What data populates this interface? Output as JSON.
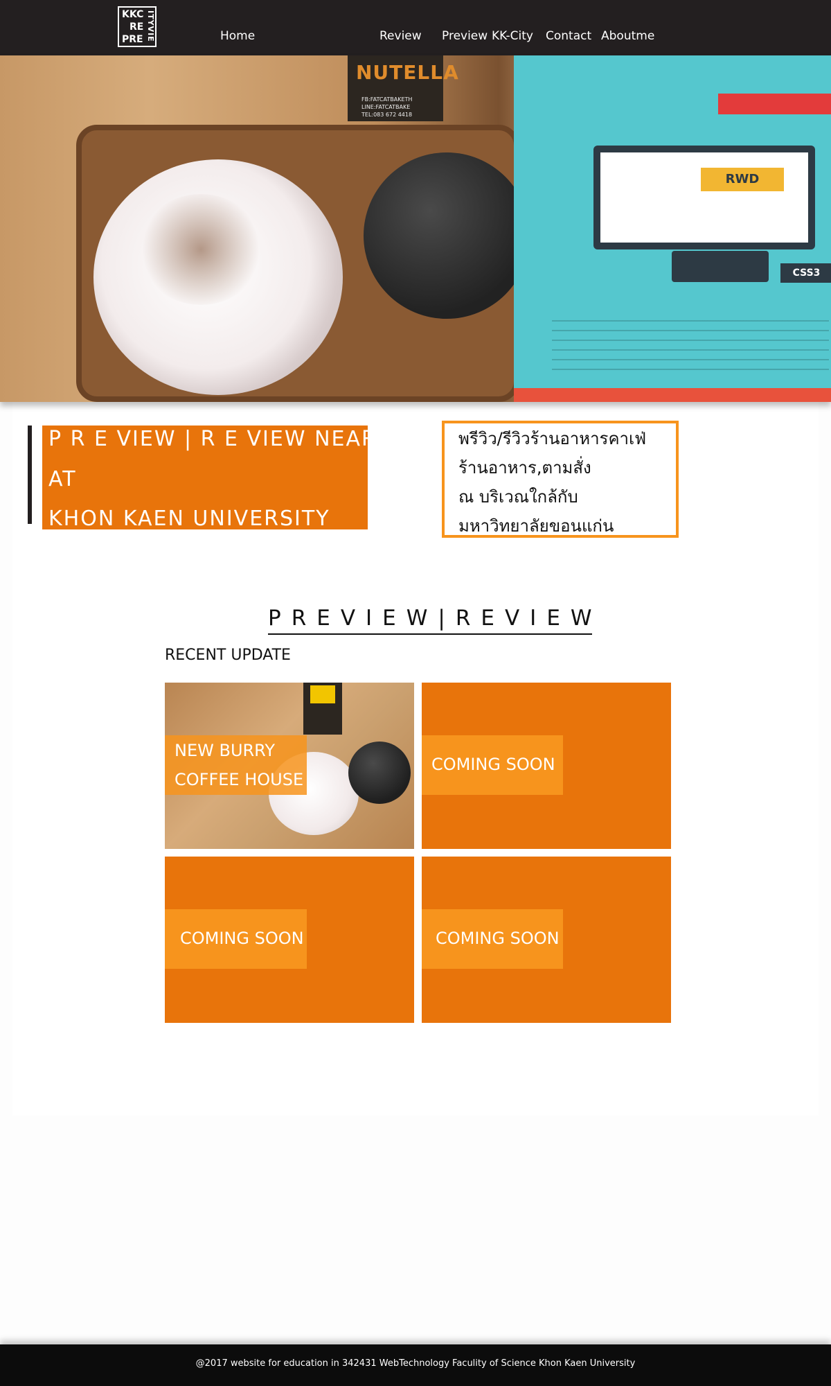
{
  "header": {
    "logo": {
      "line1": "KKC",
      "line2": "RE",
      "line3": "PRE",
      "side": "ITYVIE"
    },
    "nav": [
      {
        "label": "Home"
      },
      {
        "label": "Review"
      },
      {
        "label": "Preview"
      },
      {
        "label": "KK-City"
      },
      {
        "label": "Contact"
      },
      {
        "label": "Aboutme"
      }
    ]
  },
  "hero": {
    "product_label": "NUTELLA",
    "product_sub": [
      "FB:FATCATBAKETH",
      "LINE:FATCATBAKE",
      "TEL:083 672 4418"
    ],
    "book_badge": "RWD",
    "book_badge2": "CSS3"
  },
  "intro": {
    "title_lines": [
      "P R E VIEW | R E VIEW NEAR",
      "AT",
      "KHON KAEN UNIVERSITY"
    ],
    "thai_lines": [
      "พรีวิว/รีวิวร้านอาหารคาเฟ่",
      "ร้านอาหาร,ตามสั่ง",
      "ณ บริเวณใกล้กับ",
      "มหาวิทยาลัยขอนแก่น"
    ]
  },
  "section": {
    "title": "PREVIEW|REVIEW",
    "subtitle": "RECENT UPDATE"
  },
  "cards": [
    {
      "lines": [
        "NEW BURRY",
        "COFFEE HOUSE"
      ]
    },
    {
      "lines": [
        "COMING SOON"
      ]
    },
    {
      "lines": [
        "COMING SOON"
      ]
    },
    {
      "lines": [
        "COMING SOON"
      ]
    }
  ],
  "footer": {
    "text": "@2017 website for education in 342431 WebTechnology Faculity of Science Khon Kaen University"
  },
  "colors": {
    "accent": "#e8740b",
    "accent_light": "#f7941d",
    "dark": "#231f20"
  }
}
